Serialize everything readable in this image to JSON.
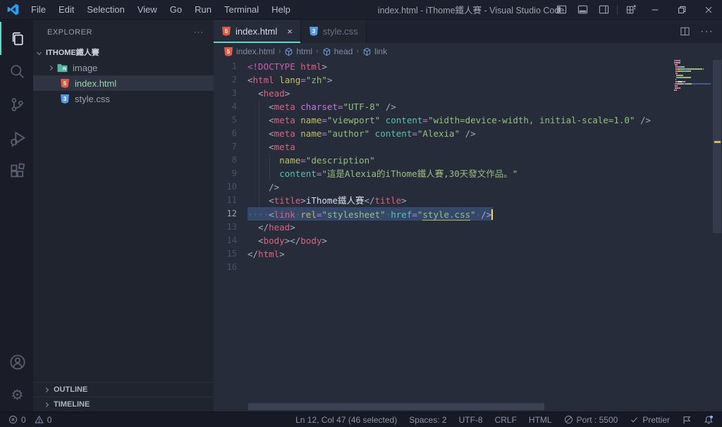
{
  "window": {
    "title": "index.html - iThome鐵人賽 - Visual Studio Code",
    "menus": [
      "File",
      "Edit",
      "Selection",
      "View",
      "Go",
      "Run",
      "Terminal",
      "Help"
    ],
    "layout_icons": [
      "toggle-primary-sidebar-icon",
      "toggle-panel-icon",
      "toggle-secondary-sidebar-icon",
      "customize-layout-icon"
    ],
    "window_controls": [
      "minimize-icon",
      "restore-icon",
      "close-icon"
    ]
  },
  "activity_bar": {
    "top": [
      {
        "icon": "explorer-icon",
        "active": true
      },
      {
        "icon": "search-icon",
        "active": false
      },
      {
        "icon": "source-control-icon",
        "active": false
      },
      {
        "icon": "run-debug-icon",
        "active": false
      },
      {
        "icon": "extensions-icon",
        "active": false
      }
    ],
    "bottom": [
      {
        "icon": "account-icon"
      },
      {
        "icon": "settings-gear-icon"
      }
    ]
  },
  "sidebar": {
    "header": "EXPLORER",
    "header_more": "···",
    "root_folder": "ITHOME鐵人賽",
    "files": [
      {
        "label": "image",
        "icon": "folder-image-icon",
        "chevron": true,
        "selected": false
      },
      {
        "label": "index.html",
        "icon": "html-icon",
        "chevron": false,
        "selected": true
      },
      {
        "label": "style.css",
        "icon": "css-icon",
        "chevron": false,
        "selected": false
      }
    ],
    "sections": [
      "OUTLINE",
      "TIMELINE"
    ]
  },
  "editor": {
    "tabs": [
      {
        "label": "index.html",
        "icon": "html-icon",
        "active": true,
        "close": "×"
      },
      {
        "label": "style.css",
        "icon": "css-icon",
        "active": false,
        "close": ""
      }
    ],
    "breadcrumbs": [
      {
        "label": "index.html",
        "icon": "html-icon"
      },
      {
        "label": "html",
        "icon": "symbol-cube-icon"
      },
      {
        "label": "head",
        "icon": "symbol-cube-icon"
      },
      {
        "label": "link",
        "icon": "symbol-cube-icon"
      }
    ],
    "code": {
      "lines": [
        {
          "n": 1,
          "sel": false,
          "tokens": [
            [
              "doc",
              "<!DOCTYPE"
            ],
            [
              "tag",
              " html"
            ],
            [
              "p",
              ">"
            ]
          ]
        },
        {
          "n": 2,
          "sel": false,
          "tokens": [
            [
              "p",
              "<"
            ],
            [
              "tag",
              "html"
            ],
            [
              "a1",
              " lang"
            ],
            [
              "eq",
              "="
            ],
            [
              "s",
              "\"zh\""
            ],
            [
              "p",
              ">"
            ]
          ]
        },
        {
          "n": 3,
          "sel": false,
          "tokens": [
            [
              "p",
              "  <"
            ],
            [
              "tag",
              "head"
            ],
            [
              "p",
              ">"
            ]
          ]
        },
        {
          "n": 4,
          "sel": false,
          "tokens": [
            [
              "p",
              "    <"
            ],
            [
              "tag",
              "meta"
            ],
            [
              "ap",
              " charset"
            ],
            [
              "eq",
              "="
            ],
            [
              "s",
              "\"UTF-8\""
            ],
            [
              "p",
              " />"
            ]
          ]
        },
        {
          "n": 5,
          "sel": false,
          "tokens": [
            [
              "p",
              "    <"
            ],
            [
              "tag",
              "meta"
            ],
            [
              "a1",
              " name"
            ],
            [
              "eq",
              "="
            ],
            [
              "s",
              "\"viewport\""
            ],
            [
              "a2",
              " content"
            ],
            [
              "eq",
              "="
            ],
            [
              "s",
              "\"width=device-width, initial-scale=1.0\""
            ],
            [
              "p",
              " />"
            ]
          ]
        },
        {
          "n": 6,
          "sel": false,
          "tokens": [
            [
              "p",
              "    <"
            ],
            [
              "tag",
              "meta"
            ],
            [
              "a1",
              " name"
            ],
            [
              "eq",
              "="
            ],
            [
              "s",
              "\"author\""
            ],
            [
              "a2",
              " content"
            ],
            [
              "eq",
              "="
            ],
            [
              "s",
              "\"Alexia\""
            ],
            [
              "p",
              " />"
            ]
          ]
        },
        {
          "n": 7,
          "sel": false,
          "tokens": [
            [
              "p",
              "    <"
            ],
            [
              "tag",
              "meta"
            ]
          ]
        },
        {
          "n": 8,
          "sel": false,
          "tokens": [
            [
              "a1",
              "      name"
            ],
            [
              "eq",
              "="
            ],
            [
              "s",
              "\"description\""
            ]
          ]
        },
        {
          "n": 9,
          "sel": false,
          "tokens": [
            [
              "a2",
              "      content"
            ],
            [
              "eq",
              "="
            ],
            [
              "s",
              "\"這是Alexia的iThome鐵人賽,30天發文作品。\""
            ]
          ]
        },
        {
          "n": 10,
          "sel": false,
          "tokens": [
            [
              "p",
              "    />"
            ]
          ]
        },
        {
          "n": 11,
          "sel": false,
          "tokens": [
            [
              "p",
              "    <"
            ],
            [
              "tag",
              "title"
            ],
            [
              "p",
              ">"
            ],
            [
              "t",
              "iThome鐵人賽"
            ],
            [
              "p",
              "</"
            ],
            [
              "tag",
              "title"
            ],
            [
              "p",
              ">"
            ]
          ]
        },
        {
          "n": 12,
          "sel": true,
          "tokens": [
            [
              "ws",
              "····"
            ],
            [
              "p",
              "<"
            ],
            [
              "tag",
              "link"
            ],
            [
              "ws",
              "·"
            ],
            [
              "a1",
              "rel"
            ],
            [
              "eq",
              "="
            ],
            [
              "s",
              "\"stylesheet\""
            ],
            [
              "ws",
              "·"
            ],
            [
              "a2",
              "href"
            ],
            [
              "eq",
              "="
            ],
            [
              "s",
              "\""
            ],
            [
              "su",
              "style.css"
            ],
            [
              "s",
              "\""
            ],
            [
              "ws",
              "·"
            ],
            [
              "p",
              "/>"
            ],
            [
              "cur",
              ""
            ]
          ]
        },
        {
          "n": 13,
          "sel": false,
          "tokens": [
            [
              "p",
              "  </"
            ],
            [
              "tag",
              "head"
            ],
            [
              "p",
              ">"
            ]
          ]
        },
        {
          "n": 14,
          "sel": false,
          "tokens": [
            [
              "p",
              "  <"
            ],
            [
              "tag",
              "body"
            ],
            [
              "p",
              ">"
            ],
            [
              "p",
              "</"
            ],
            [
              "tag",
              "body"
            ],
            [
              "p",
              ">"
            ]
          ]
        },
        {
          "n": 15,
          "sel": false,
          "tokens": [
            [
              "p",
              "</"
            ],
            [
              "tag",
              "html"
            ],
            [
              "p",
              ">"
            ]
          ]
        },
        {
          "n": 16,
          "sel": false,
          "tokens": []
        }
      ]
    }
  },
  "status_bar": {
    "left": [
      {
        "icon": "error-icon",
        "label": "0"
      },
      {
        "icon": "warning-icon",
        "label": "0"
      }
    ],
    "right": [
      {
        "icon": "",
        "label": "Ln 12, Col 47 (46 selected)"
      },
      {
        "icon": "",
        "label": "Spaces: 2"
      },
      {
        "icon": "",
        "label": "UTF-8"
      },
      {
        "icon": "",
        "label": "CRLF"
      },
      {
        "icon": "",
        "label": "HTML"
      },
      {
        "icon": "port-icon",
        "label": "Port : 5500"
      },
      {
        "icon": "check-icon",
        "label": "Prettier"
      },
      {
        "icon": "feedback-icon",
        "label": ""
      },
      {
        "icon": "bell-icon",
        "label": ""
      }
    ]
  },
  "palette": {
    "accent": "#5fd7c8",
    "selection": "#36486a",
    "doc": "#c75fb0",
    "tag": "#e0607e",
    "p": "#a6aebe",
    "a1": "#bcc158",
    "a2": "#53c1ae",
    "ap": "#c678dd",
    "eq": "#c678dd",
    "s": "#93c179",
    "su": "#93c179",
    "t": "#d6dbe5",
    "ws": "#5d6a86",
    "cursor": "#ffd35c"
  }
}
